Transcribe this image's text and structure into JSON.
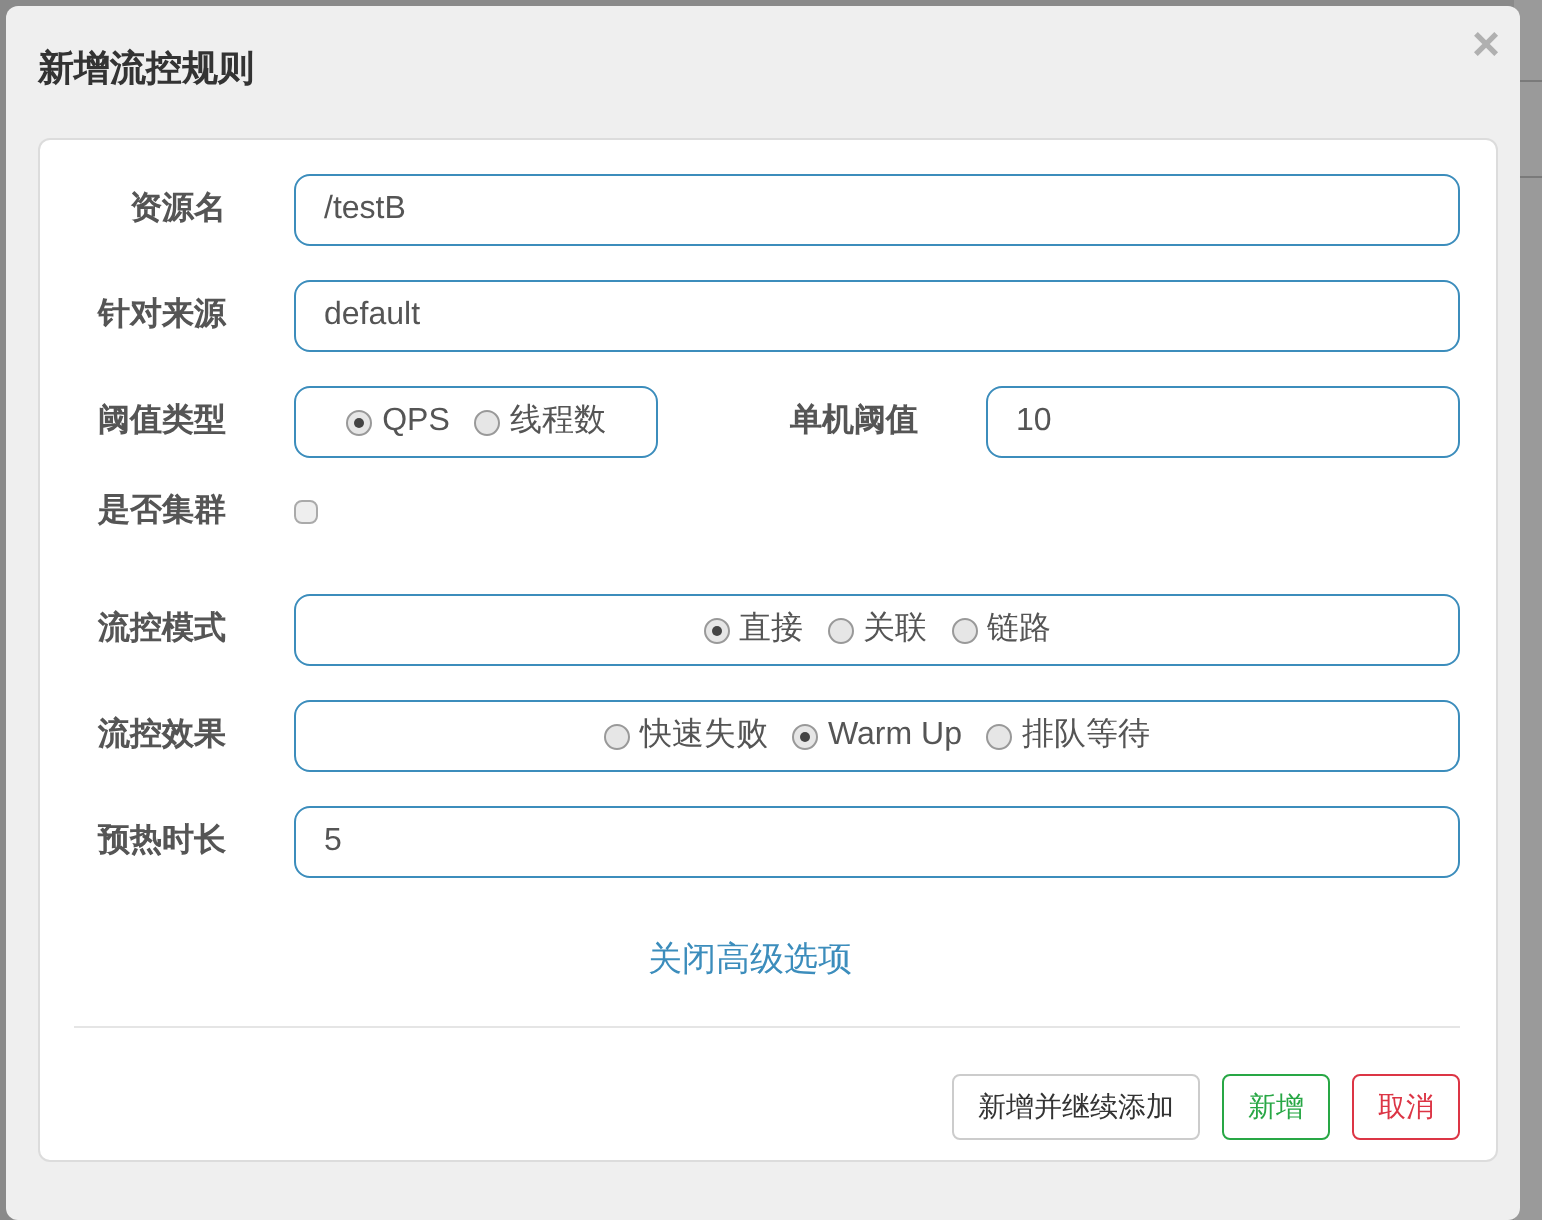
{
  "dialog": {
    "title": "新增流控规则",
    "close": "×"
  },
  "fields": [
    {
      "kind": "text",
      "label": "资源名",
      "value": "/testB"
    },
    {
      "kind": "text",
      "label": "针对来源",
      "value": "default"
    },
    {
      "kind": "radio",
      "label": "阈值类型",
      "options": [
        {
          "label": "QPS",
          "selected": true
        },
        {
          "label": "线程数",
          "selected": false
        }
      ],
      "extra": {
        "label": "单机阈值",
        "value": "10"
      }
    },
    {
      "kind": "checkbox",
      "label": "是否集群",
      "checked": false
    },
    {
      "kind": "radio",
      "label": "流控模式",
      "options": [
        {
          "label": "直接",
          "selected": true
        },
        {
          "label": "关联",
          "selected": false
        },
        {
          "label": "链路",
          "selected": false
        }
      ]
    },
    {
      "kind": "radio",
      "label": "流控效果",
      "options": [
        {
          "label": "快速失败",
          "selected": false
        },
        {
          "label": "Warm Up",
          "selected": true
        },
        {
          "label": "排队等待",
          "selected": false
        }
      ]
    },
    {
      "kind": "text",
      "label": "预热时长",
      "value": "5"
    }
  ],
  "advanced_link": "关闭高级选项",
  "buttons": [
    {
      "label": "新增并继续添加",
      "kind": "default"
    },
    {
      "label": "新增",
      "kind": "success"
    },
    {
      "label": "取消",
      "kind": "danger"
    }
  ]
}
